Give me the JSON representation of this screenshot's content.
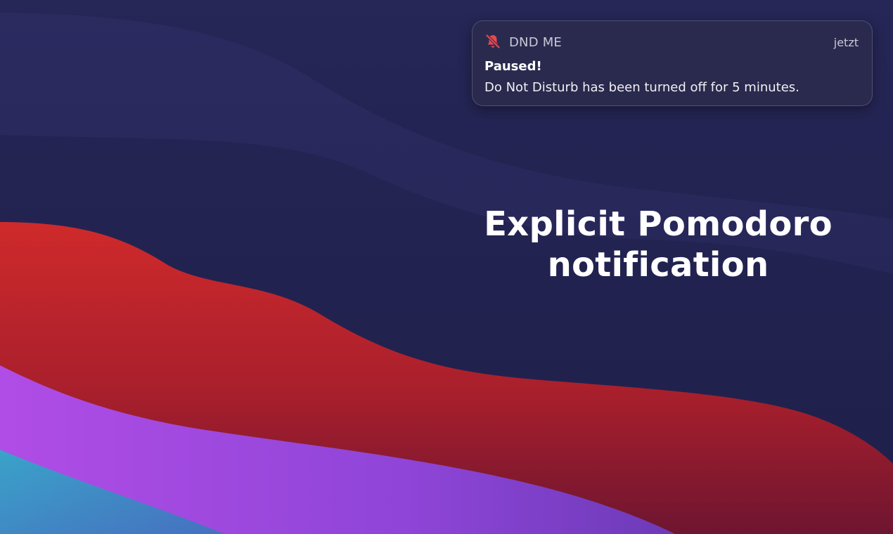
{
  "notification": {
    "app_name": "DND ME",
    "app_icon": "bell-slash-icon",
    "timestamp": "jetzt",
    "title": "Paused!",
    "body": "Do Not Disturb has been turned off for 5 minutes."
  },
  "overlay": {
    "heading_line1": "Explicit Pomodoro",
    "heading_line2": "notification"
  },
  "colors": {
    "background": "#23234f",
    "wave_red": "#c9282c",
    "wave_purple": "#a24be0",
    "wave_teal": "#3e97c4",
    "app_icon_red": "#e5484d"
  }
}
